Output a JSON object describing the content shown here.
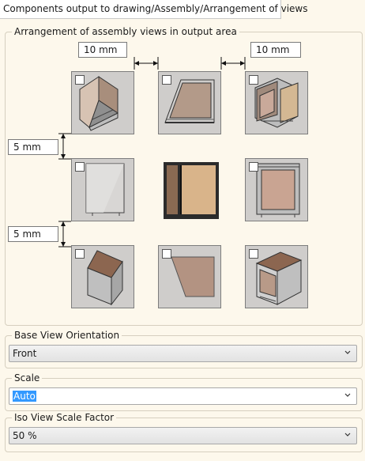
{
  "breadcrumb": "Components output to drawing/Assembly/Arrangement of views",
  "arrangement": {
    "title": "Arrangement of assembly views in output area",
    "horizontal_gap_left": "10 mm",
    "horizontal_gap_right": "10 mm",
    "vertical_gap_top": "5 mm",
    "vertical_gap_bottom": "5 mm"
  },
  "base_view_orientation": {
    "title": "Base View Orientation",
    "value": "Front"
  },
  "scale": {
    "title": "Scale",
    "value": "Auto"
  },
  "iso_view_scale_factor": {
    "title": "Iso View Scale Factor",
    "value": "50 %"
  },
  "colors": {
    "panel_bg": "#fdf8ec",
    "cabinet_wood": "#b8a290",
    "cabinet_top": "#8c6650",
    "selection": "#3399ff"
  }
}
